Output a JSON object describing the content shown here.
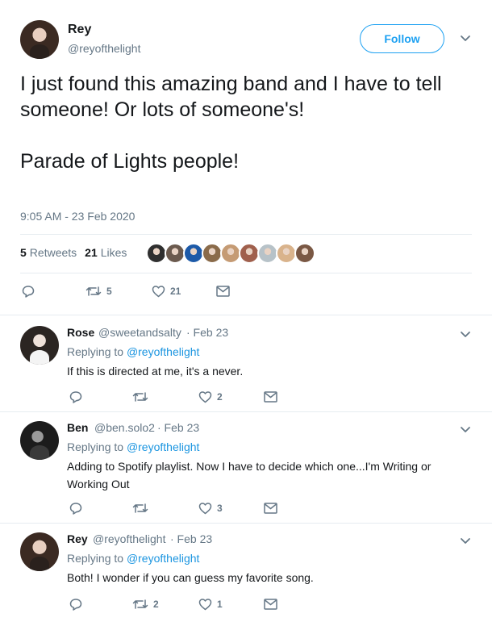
{
  "tweet": {
    "author_name": "Rey",
    "author_handle": "@reyofthelight",
    "follow_label": "Follow",
    "text": "I just found this amazing band and I have to tell someone! Or lots of someone's!\n\nParade of Lights people!",
    "timestamp": "9:05 AM - 23 Feb 2020",
    "retweets_count": "5",
    "retweets_label": "Retweets",
    "likes_count": "21",
    "likes_label": "Likes",
    "actions": {
      "retweet_count": "5",
      "like_count": "21"
    }
  },
  "liker_colors": [
    "#2f2f2f",
    "#6b5a4e",
    "#1d5aa8",
    "#8a6b4a",
    "#c59b74",
    "#a0604d",
    "#b7c2c8",
    "#d9b38c",
    "#7a5844"
  ],
  "replies": [
    {
      "name": "Rose",
      "handle": "@sweetandsalty",
      "date": "· Feb 23",
      "replying_prefix": "Replying to",
      "replying_to": "@reyofthelight",
      "text": "If this is directed at me, it's a never.",
      "retweet_count": "",
      "like_count": "2"
    },
    {
      "name": "Ben",
      "handle": "@ben.solo2",
      "date": "· Feb 23",
      "replying_prefix": "Replying to",
      "replying_to": "@reyofthelight",
      "text": "Adding to Spotify playlist. Now I have to decide which one...I'm Writing or Working Out",
      "retweet_count": "",
      "like_count": "3"
    },
    {
      "name": "Rey",
      "handle": "@reyofthelight",
      "date": "· Feb 23",
      "replying_prefix": "Replying to",
      "replying_to": "@reyofthelight",
      "text": "Both! I wonder if you can guess my favorite song.",
      "retweet_count": "2",
      "like_count": "1"
    }
  ],
  "icons": {
    "reply": "reply-icon",
    "retweet": "retweet-icon",
    "like": "like-icon",
    "dm": "direct-message-icon",
    "more": "chevron-down-icon"
  },
  "colors": {
    "accent": "#1da1f2",
    "link": "#1b95e0",
    "muted": "#657786",
    "border": "#e6ecf0"
  }
}
